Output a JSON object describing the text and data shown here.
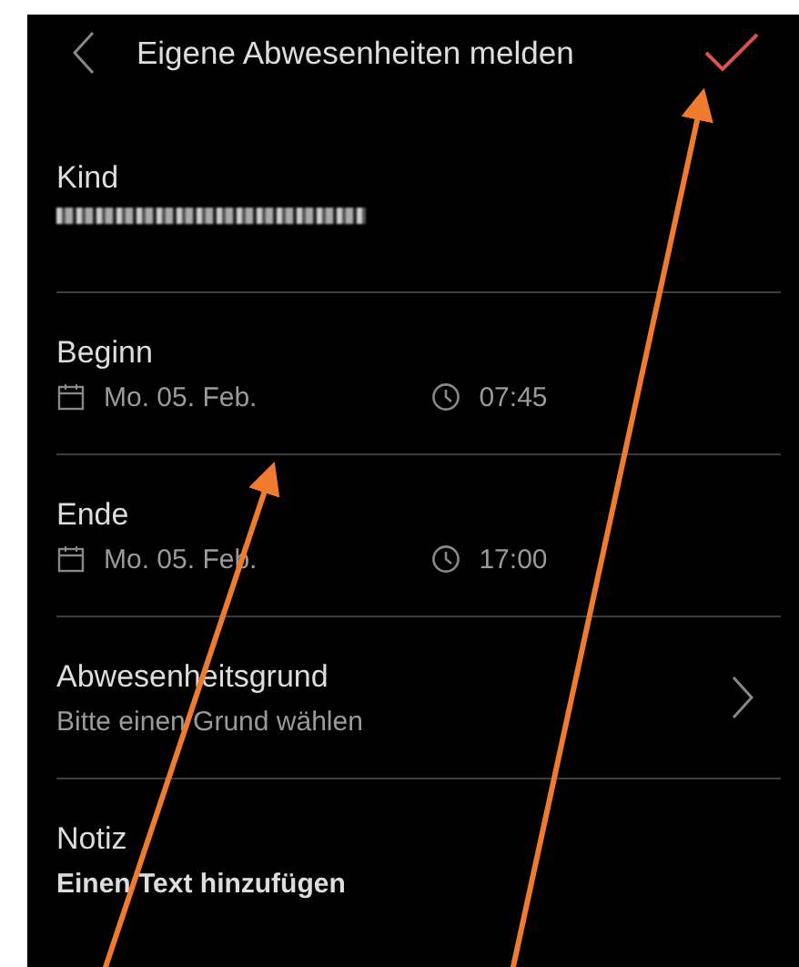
{
  "header": {
    "title": "Eigene Abwesenheiten melden"
  },
  "fields": [
    {
      "kind": "blurred",
      "label": "Kind",
      "blurred": true
    },
    {
      "kind": "datetime",
      "label": "Beginn",
      "date": "Mo. 05. Feb.",
      "time": "07:45"
    },
    {
      "kind": "datetime",
      "label": "Ende",
      "date": "Mo. 05. Feb.",
      "time": "17:00"
    },
    {
      "kind": "picker",
      "label": "Abwesenheitsgrund",
      "placeholder": "Bitte einen Grund wählen"
    },
    {
      "kind": "note",
      "label": "Notiz",
      "placeholder": "Einen Text hinzufügen"
    }
  ],
  "annotations": [
    {
      "kind": "arrow"
    },
    {
      "kind": "arrow"
    }
  ]
}
